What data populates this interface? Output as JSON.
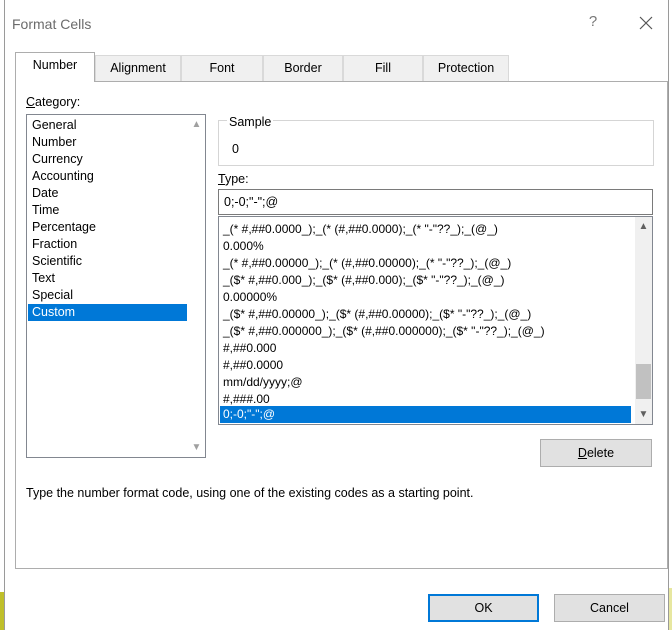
{
  "window": {
    "title": "Format Cells",
    "help": "?"
  },
  "tabs": [
    "Number",
    "Alignment",
    "Font",
    "Border",
    "Fill",
    "Protection"
  ],
  "category": {
    "label_pre": "",
    "label_u": "C",
    "label_post": "ategory:",
    "items": [
      "General",
      "Number",
      "Currency",
      "Accounting",
      "Date",
      "Time",
      "Percentage",
      "Fraction",
      "Scientific",
      "Text",
      "Special",
      "Custom"
    ],
    "selected": "Custom"
  },
  "sample": {
    "label": "Sample",
    "value": "0"
  },
  "type": {
    "label_u": "T",
    "label_post": "ype:",
    "value": "0;-0;\"-\";@",
    "formats": [
      "_(* #,##0.0000_);_(* (#,##0.0000);_(* \"-\"??_);_(@_)",
      "0.000%",
      "_(* #,##0.00000_);_(* (#,##0.00000);_(* \"-\"??_);_(@_)",
      "_($* #,##0.000_);_($* (#,##0.000);_($* \"-\"??_);_(@_)",
      "0.00000%",
      "_($* #,##0.00000_);_($* (#,##0.00000);_($* \"-\"??_);_(@_)",
      "_($* #,##0.000000_);_($* (#,##0.000000);_($* \"-\"??_);_(@_)",
      "#,##0.000",
      "#,##0.0000",
      "mm/dd/yyyy;@",
      "#,###.00",
      "0;-0;\"-\";@"
    ],
    "selected": "0;-0;\"-\";@"
  },
  "buttons": {
    "delete_u": "D",
    "delete_post": "elete",
    "ok": "OK",
    "cancel": "Cancel"
  },
  "description": "Type the number format code, using one of the existing codes as a starting point."
}
